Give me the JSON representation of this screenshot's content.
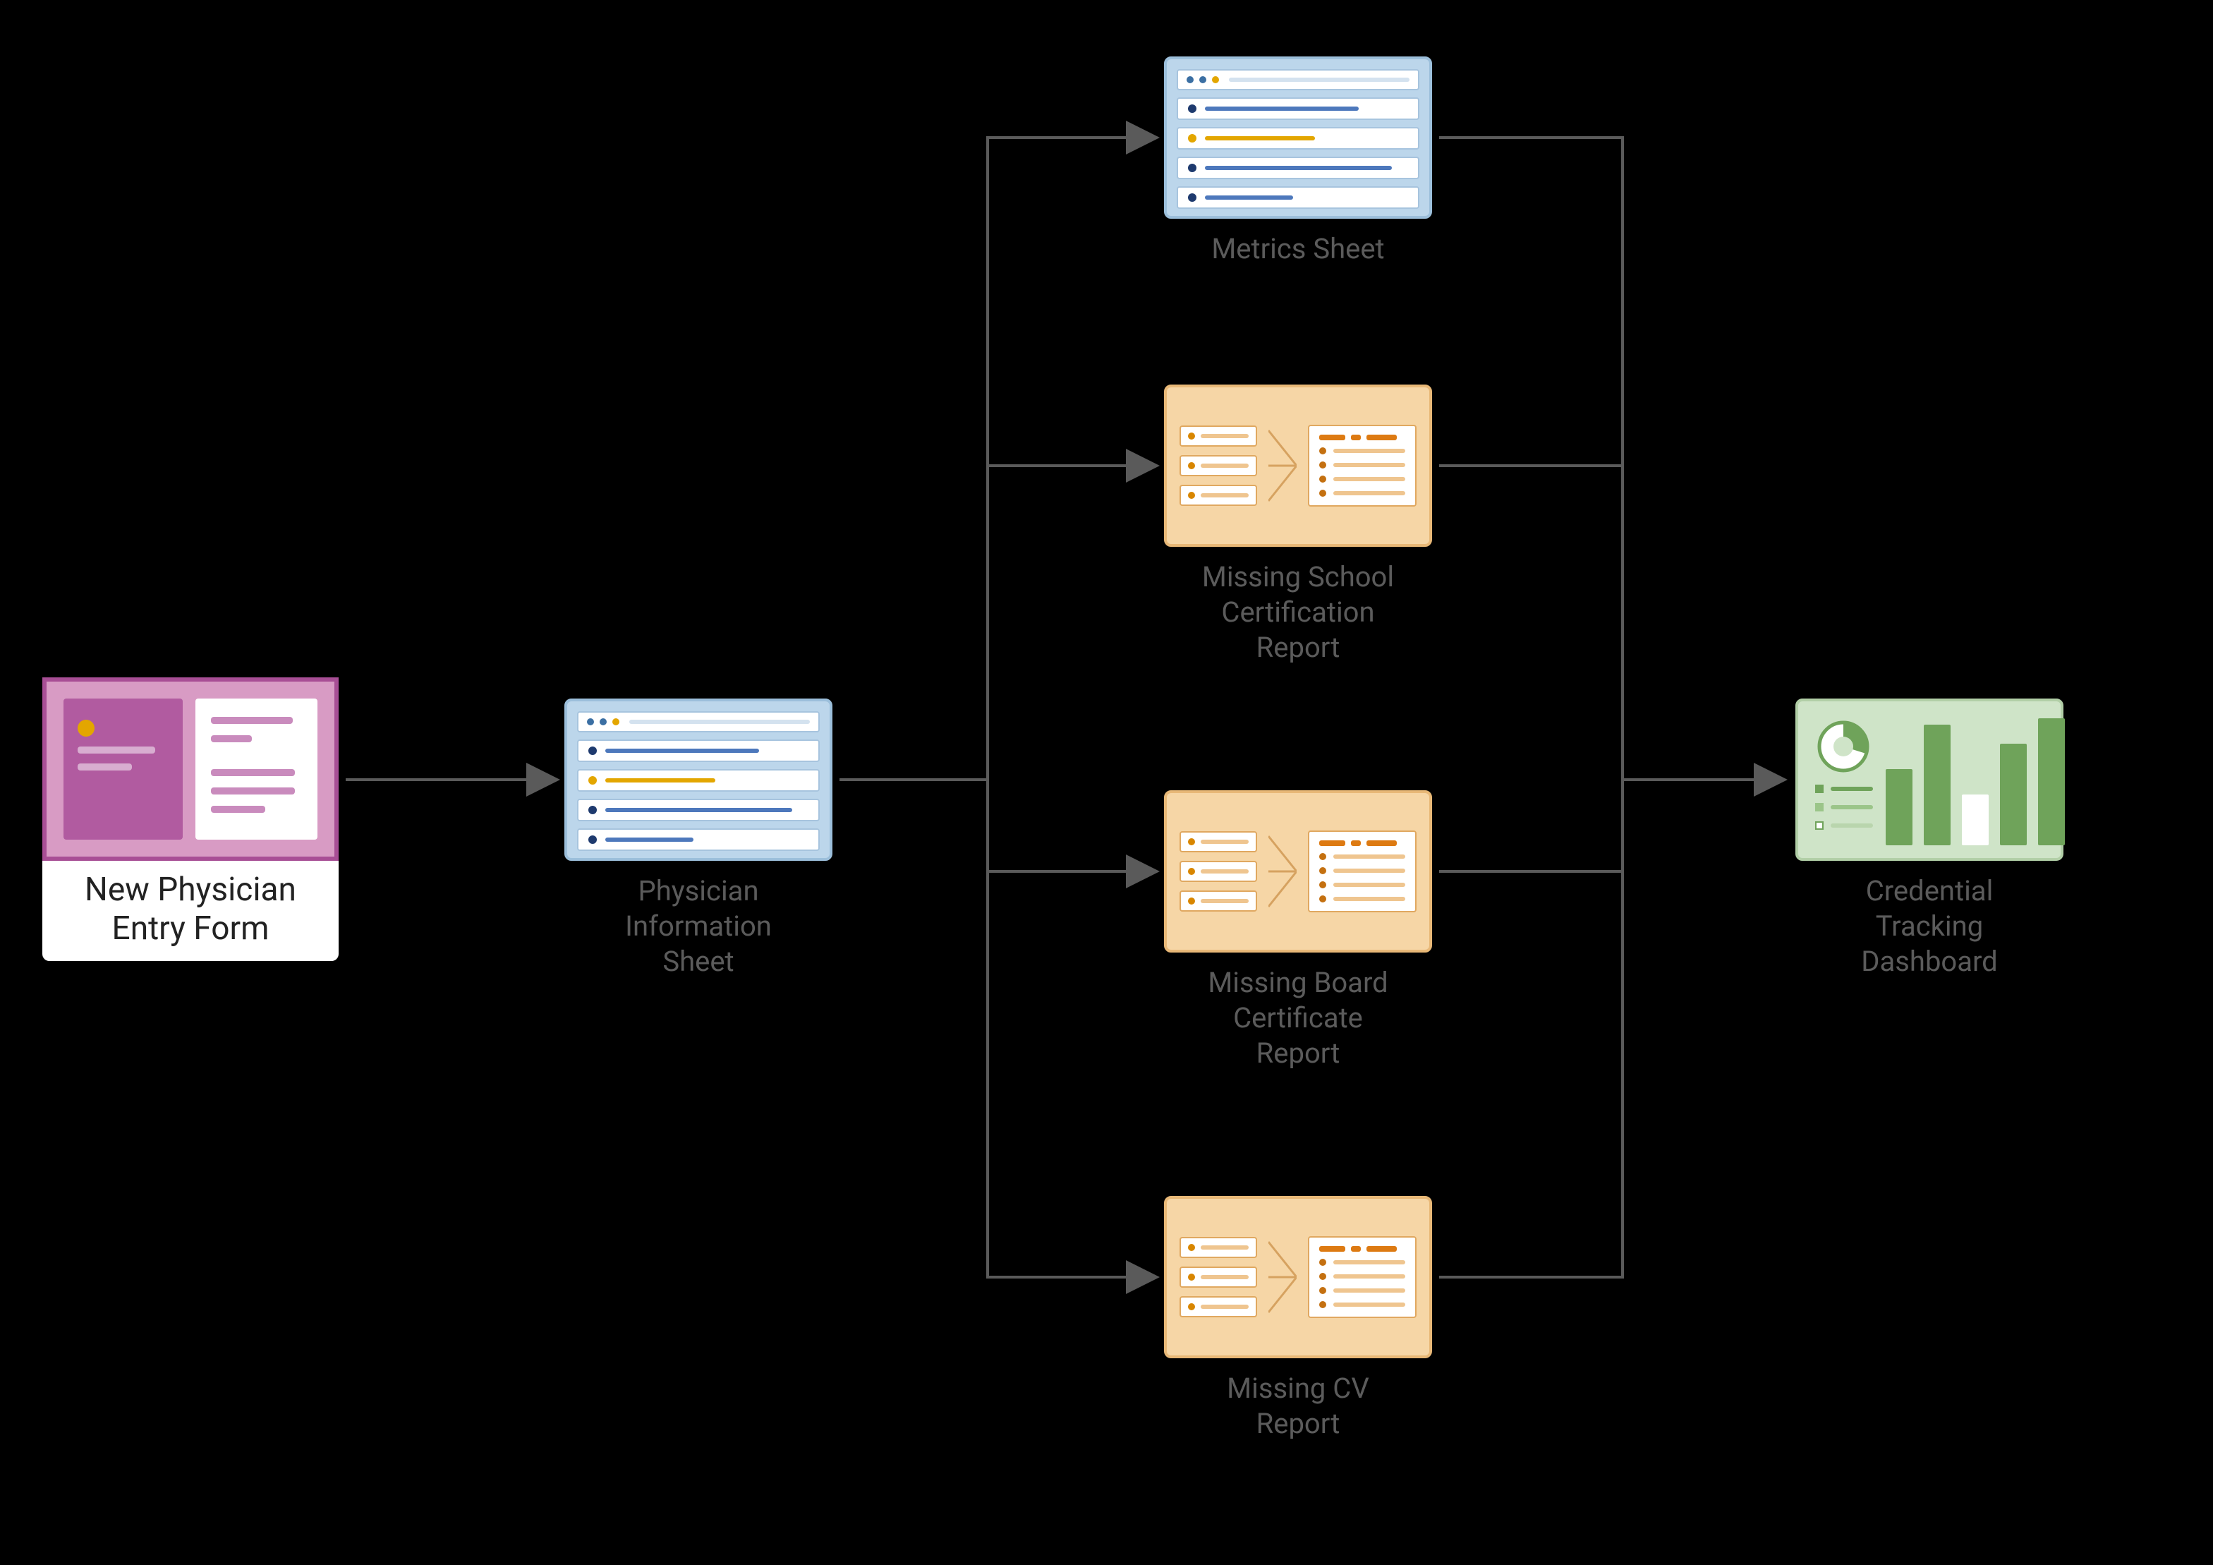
{
  "nodes": {
    "entry_form": {
      "label": "New Physician\nEntry Form"
    },
    "info_sheet": {
      "label": "Physician\nInformation\nSheet"
    },
    "metrics": {
      "label": "Metrics Sheet"
    },
    "school_cert": {
      "label": "Missing School\nCertification\nReport"
    },
    "board_cert": {
      "label": "Missing Board\nCertificate\nReport"
    },
    "cv_report": {
      "label": "Missing CV\nReport"
    },
    "dashboard": {
      "label": "Credential\nTracking\nDashboard"
    }
  },
  "edges": [
    {
      "from": "entry_form",
      "to": "info_sheet"
    },
    {
      "from": "info_sheet",
      "to": "metrics"
    },
    {
      "from": "info_sheet",
      "to": "school_cert"
    },
    {
      "from": "info_sheet",
      "to": "board_cert"
    },
    {
      "from": "info_sheet",
      "to": "cv_report"
    },
    {
      "from": "metrics",
      "to": "dashboard"
    },
    {
      "from": "school_cert",
      "to": "dashboard"
    },
    {
      "from": "board_cert",
      "to": "dashboard"
    },
    {
      "from": "cv_report",
      "to": "dashboard"
    }
  ],
  "colors": {
    "pink_bg": "#d89bc4",
    "pink_border": "#a84e95",
    "blue_bg": "#bcd6eb",
    "orange_bg": "#f6d6a6",
    "green_bg": "#cfe4c8",
    "arrow": "#5a5a5a"
  }
}
